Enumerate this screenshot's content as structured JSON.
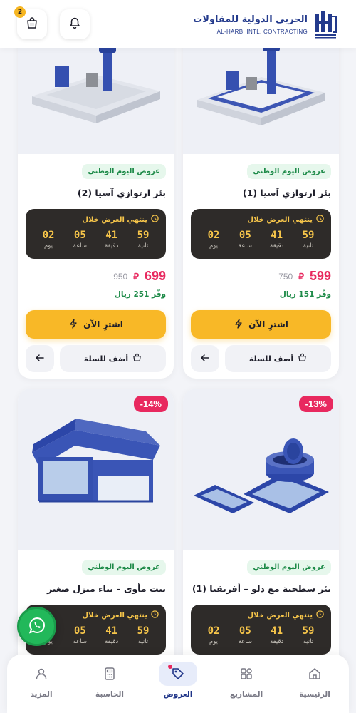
{
  "header": {
    "brand_ar": "الحربي الدولية للمقاولات",
    "brand_en": "AL-HARBI INTL. CONTRACTING",
    "cart_count": "2",
    "brand_color": "#233a8c"
  },
  "products": [
    {
      "tag": "عروض اليوم الوطني",
      "title": "بئر ارتوازي آسيا (1)",
      "timer_label": "ينتهي العرض خلال",
      "timer": [
        {
          "value": "59",
          "unit": "ثانية"
        },
        {
          "value": "41",
          "unit": "دقيقة"
        },
        {
          "value": "05",
          "unit": "ساعة"
        },
        {
          "value": "02",
          "unit": "يوم"
        }
      ],
      "price": "599",
      "old_price": "750",
      "save": "وفّر 151 ريال",
      "buy": "اشترِ الآن",
      "add_to_cart": "أضف للسلة"
    },
    {
      "tag": "عروض اليوم الوطني",
      "title": "بئر ارتوازي آسيا (2)",
      "timer_label": "ينتهي العرض خلال",
      "timer": [
        {
          "value": "59",
          "unit": "ثانية"
        },
        {
          "value": "41",
          "unit": "دقيقة"
        },
        {
          "value": "05",
          "unit": "ساعة"
        },
        {
          "value": "02",
          "unit": "يوم"
        }
      ],
      "price": "699",
      "old_price": "950",
      "save": "وفّر 251 ريال",
      "buy": "اشترِ الآن",
      "add_to_cart": "أضف للسلة"
    },
    {
      "discount": "-13%",
      "tag": "عروض اليوم الوطني",
      "title": "بئر سطحية مع دلو – أفريقيا (1)",
      "timer_label": "ينتهي العرض خلال",
      "timer": [
        {
          "value": "59",
          "unit": "ثانية"
        },
        {
          "value": "41",
          "unit": "دقيقة"
        },
        {
          "value": "05",
          "unit": "ساعة"
        },
        {
          "value": "02",
          "unit": "يوم"
        }
      ]
    },
    {
      "discount": "-14%",
      "tag": "عروض اليوم الوطني",
      "title": "بيت مأوى – بناء منزل صغير",
      "timer_label": "ينتهي العرض خلال",
      "timer": [
        {
          "value": "59",
          "unit": "ثانية"
        },
        {
          "value": "41",
          "unit": "دقيقة"
        },
        {
          "value": "05",
          "unit": "ساعة"
        },
        {
          "value": "02",
          "unit": "يوم"
        }
      ]
    }
  ],
  "nav": [
    {
      "label": "الرئيسية",
      "icon": "home-icon",
      "active": false
    },
    {
      "label": "المشاريع",
      "icon": "grid-icon",
      "active": false
    },
    {
      "label": "العروض",
      "icon": "tag-icon",
      "active": true
    },
    {
      "label": "الحاسبة",
      "icon": "calculator-icon",
      "active": false
    },
    {
      "label": "المزيد",
      "icon": "user-icon",
      "active": false
    }
  ],
  "colors": {
    "accent": "#f8b827",
    "price": "#e8295f",
    "timer_bg": "#2e2b29",
    "tag_green": "#1d8a48"
  }
}
